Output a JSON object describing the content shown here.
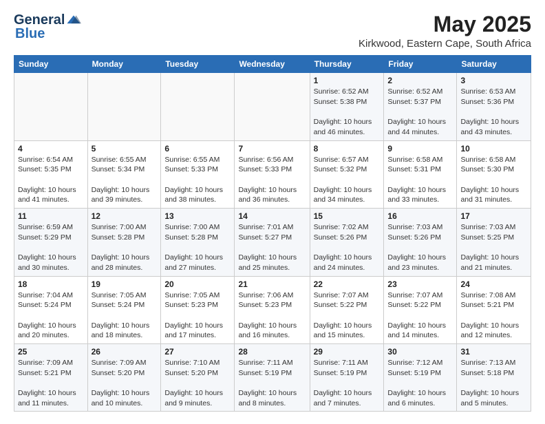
{
  "header": {
    "logo_general": "General",
    "logo_blue": "Blue",
    "month_year": "May 2025",
    "location": "Kirkwood, Eastern Cape, South Africa"
  },
  "days_of_week": [
    "Sunday",
    "Monday",
    "Tuesday",
    "Wednesday",
    "Thursday",
    "Friday",
    "Saturday"
  ],
  "weeks": [
    [
      {
        "day": "",
        "info": ""
      },
      {
        "day": "",
        "info": ""
      },
      {
        "day": "",
        "info": ""
      },
      {
        "day": "",
        "info": ""
      },
      {
        "day": "1",
        "info": "Sunrise: 6:52 AM\nSunset: 5:38 PM\nDaylight: 10 hours and 46 minutes."
      },
      {
        "day": "2",
        "info": "Sunrise: 6:52 AM\nSunset: 5:37 PM\nDaylight: 10 hours and 44 minutes."
      },
      {
        "day": "3",
        "info": "Sunrise: 6:53 AM\nSunset: 5:36 PM\nDaylight: 10 hours and 43 minutes."
      }
    ],
    [
      {
        "day": "4",
        "info": "Sunrise: 6:54 AM\nSunset: 5:35 PM\nDaylight: 10 hours and 41 minutes."
      },
      {
        "day": "5",
        "info": "Sunrise: 6:55 AM\nSunset: 5:34 PM\nDaylight: 10 hours and 39 minutes."
      },
      {
        "day": "6",
        "info": "Sunrise: 6:55 AM\nSunset: 5:33 PM\nDaylight: 10 hours and 38 minutes."
      },
      {
        "day": "7",
        "info": "Sunrise: 6:56 AM\nSunset: 5:33 PM\nDaylight: 10 hours and 36 minutes."
      },
      {
        "day": "8",
        "info": "Sunrise: 6:57 AM\nSunset: 5:32 PM\nDaylight: 10 hours and 34 minutes."
      },
      {
        "day": "9",
        "info": "Sunrise: 6:58 AM\nSunset: 5:31 PM\nDaylight: 10 hours and 33 minutes."
      },
      {
        "day": "10",
        "info": "Sunrise: 6:58 AM\nSunset: 5:30 PM\nDaylight: 10 hours and 31 minutes."
      }
    ],
    [
      {
        "day": "11",
        "info": "Sunrise: 6:59 AM\nSunset: 5:29 PM\nDaylight: 10 hours and 30 minutes."
      },
      {
        "day": "12",
        "info": "Sunrise: 7:00 AM\nSunset: 5:28 PM\nDaylight: 10 hours and 28 minutes."
      },
      {
        "day": "13",
        "info": "Sunrise: 7:00 AM\nSunset: 5:28 PM\nDaylight: 10 hours and 27 minutes."
      },
      {
        "day": "14",
        "info": "Sunrise: 7:01 AM\nSunset: 5:27 PM\nDaylight: 10 hours and 25 minutes."
      },
      {
        "day": "15",
        "info": "Sunrise: 7:02 AM\nSunset: 5:26 PM\nDaylight: 10 hours and 24 minutes."
      },
      {
        "day": "16",
        "info": "Sunrise: 7:03 AM\nSunset: 5:26 PM\nDaylight: 10 hours and 23 minutes."
      },
      {
        "day": "17",
        "info": "Sunrise: 7:03 AM\nSunset: 5:25 PM\nDaylight: 10 hours and 21 minutes."
      }
    ],
    [
      {
        "day": "18",
        "info": "Sunrise: 7:04 AM\nSunset: 5:24 PM\nDaylight: 10 hours and 20 minutes."
      },
      {
        "day": "19",
        "info": "Sunrise: 7:05 AM\nSunset: 5:24 PM\nDaylight: 10 hours and 18 minutes."
      },
      {
        "day": "20",
        "info": "Sunrise: 7:05 AM\nSunset: 5:23 PM\nDaylight: 10 hours and 17 minutes."
      },
      {
        "day": "21",
        "info": "Sunrise: 7:06 AM\nSunset: 5:23 PM\nDaylight: 10 hours and 16 minutes."
      },
      {
        "day": "22",
        "info": "Sunrise: 7:07 AM\nSunset: 5:22 PM\nDaylight: 10 hours and 15 minutes."
      },
      {
        "day": "23",
        "info": "Sunrise: 7:07 AM\nSunset: 5:22 PM\nDaylight: 10 hours and 14 minutes."
      },
      {
        "day": "24",
        "info": "Sunrise: 7:08 AM\nSunset: 5:21 PM\nDaylight: 10 hours and 12 minutes."
      }
    ],
    [
      {
        "day": "25",
        "info": "Sunrise: 7:09 AM\nSunset: 5:21 PM\nDaylight: 10 hours and 11 minutes."
      },
      {
        "day": "26",
        "info": "Sunrise: 7:09 AM\nSunset: 5:20 PM\nDaylight: 10 hours and 10 minutes."
      },
      {
        "day": "27",
        "info": "Sunrise: 7:10 AM\nSunset: 5:20 PM\nDaylight: 10 hours and 9 minutes."
      },
      {
        "day": "28",
        "info": "Sunrise: 7:11 AM\nSunset: 5:19 PM\nDaylight: 10 hours and 8 minutes."
      },
      {
        "day": "29",
        "info": "Sunrise: 7:11 AM\nSunset: 5:19 PM\nDaylight: 10 hours and 7 minutes."
      },
      {
        "day": "30",
        "info": "Sunrise: 7:12 AM\nSunset: 5:19 PM\nDaylight: 10 hours and 6 minutes."
      },
      {
        "day": "31",
        "info": "Sunrise: 7:13 AM\nSunset: 5:18 PM\nDaylight: 10 hours and 5 minutes."
      }
    ]
  ]
}
